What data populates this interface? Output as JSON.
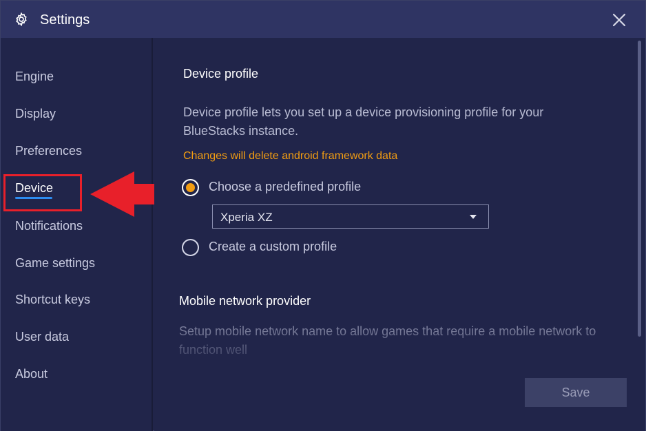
{
  "window": {
    "title": "Settings",
    "icons": {
      "settings": "gear-icon",
      "close": "close-icon"
    }
  },
  "sidebar": {
    "items": [
      {
        "label": "Engine"
      },
      {
        "label": "Display"
      },
      {
        "label": "Preferences"
      },
      {
        "label": "Device",
        "active": true
      },
      {
        "label": "Notifications"
      },
      {
        "label": "Game settings"
      },
      {
        "label": "Shortcut keys"
      },
      {
        "label": "User data"
      },
      {
        "label": "About"
      }
    ]
  },
  "device_profile": {
    "title": "Device profile",
    "description": "Device profile lets you set up a device provisioning profile for your BlueStacks instance.",
    "warning": "Changes will delete android framework data",
    "options": {
      "predefined": {
        "label": "Choose a predefined profile",
        "checked": true
      },
      "custom": {
        "label": "Create a custom profile",
        "checked": false
      }
    },
    "profile_select": {
      "value": "Xperia XZ"
    }
  },
  "mobile_network": {
    "title": "Mobile network provider",
    "description": "Setup mobile network name to allow games that require a mobile network to function well"
  },
  "actions": {
    "save_label": "Save"
  },
  "colors": {
    "title_bar": "#2f3463",
    "background": "#21254a",
    "accent_orange": "#f29d12",
    "active_underline": "#2d8cf0",
    "callout_red": "#e8202a"
  }
}
